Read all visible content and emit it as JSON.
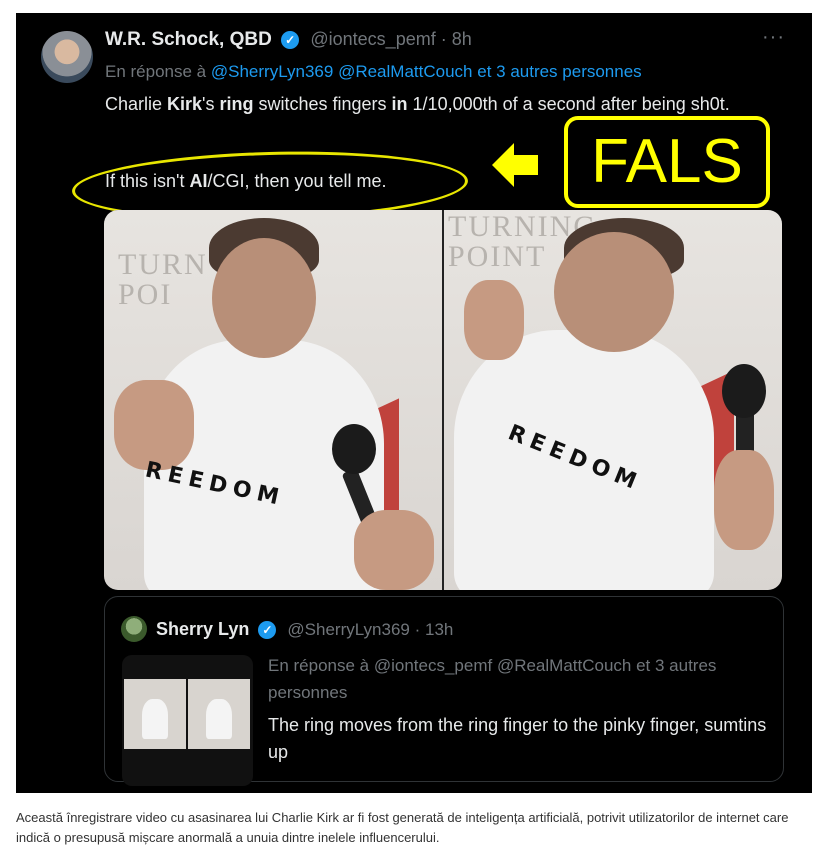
{
  "tweet": {
    "author_name": "W.R. Schock, QBD",
    "verified_mark": "✓",
    "handle_time": "@iontecs_pemf · 8h",
    "more_label": "···",
    "reply_prefix": "En réponse à",
    "reply_mentions": "@SherryLyn369 @RealMattCouch",
    "reply_suffix": "et 3 autres personnes",
    "text_p1": "Charlie ",
    "text_b1": "Kirk",
    "text_p2": "'s ",
    "text_b2": "ring",
    "text_p3": " switches fingers ",
    "text_b3": "in",
    "text_p4": " 1/10,000th of a second after being sh0t.",
    "text2_p1": "If this isn't ",
    "text2_b1": "AI",
    "text2_p2": "/CGI, then you tell me."
  },
  "annotation": {
    "label": "FALS",
    "color": "#ffff00"
  },
  "media": {
    "left_logo": "TURN\nPOI",
    "right_logo": "TURNING\nPOINT",
    "left_shirt": "REEDOM",
    "right_shirt": "REEDOM"
  },
  "quoted": {
    "author_name": "Sherry Lyn",
    "verified_mark": "✓",
    "handle_time": "@SherryLyn369 · 13h",
    "reply_line": "En réponse à @iontecs_pemf @RealMattCouch et 3 autres personnes",
    "text": "The  ring moves from the ring finger to the pinky finger, sumtins up"
  },
  "caption": "Această înregistrare video cu asasinarea lui Charlie Kirk ar fi fost generată de inteligența artificială, potrivit utilizatorilor de internet care indică o presupusă mișcare anormală a unuia dintre inelele influencerului.",
  "colors": {
    "background": "#000000",
    "text": "#e7e9ea",
    "muted": "#71767b",
    "link": "#1d9bf0",
    "highlight": "#ffff00"
  }
}
